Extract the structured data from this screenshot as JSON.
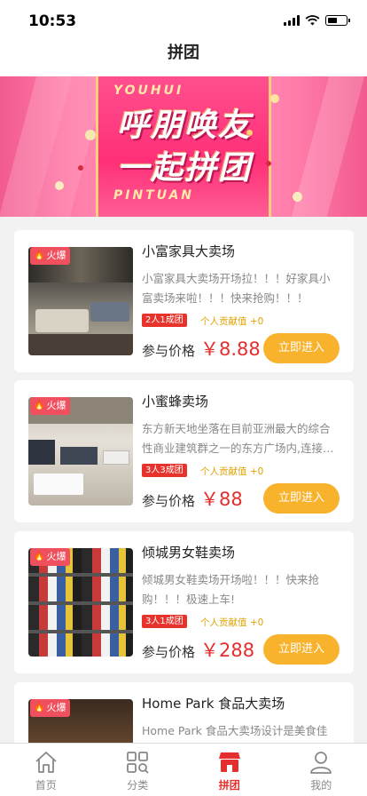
{
  "status": {
    "time": "10:53"
  },
  "nav": {
    "title": "拼团"
  },
  "banner": {
    "en_top": "YOUHUI",
    "line1": "呼朋唤友",
    "line2": "一起拼团",
    "en_bottom": "PINTUAN"
  },
  "cards": [
    {
      "title": "小富家具大卖场",
      "desc": "小富家具大卖场开场拉！！！好家具小富卖场来啦！！！快来抢购！！！",
      "group": "2人1成团",
      "contribution": "个人贡献值 +0",
      "price_label": "参与价格",
      "price": "￥8.88",
      "button": "立即进入",
      "hot": "火爆"
    },
    {
      "title": "小蜜蜂卖场",
      "desc": "东方新天地坐落在目前亚洲最大的综合性商业建筑群之一的东方广场内,连接…",
      "group": "3人3成团",
      "contribution": "个人贡献值 +0",
      "price_label": "参与价格",
      "price": "￥88",
      "button": "立即进入",
      "hot": "火爆"
    },
    {
      "title": "倾城男女鞋卖场",
      "desc": "倾城男女鞋卖场开场啦！！！快来抢购！！！极速上车!",
      "group": "3人1成团",
      "contribution": "个人贡献值 +0",
      "price_label": "参与价格",
      "price": "￥288",
      "button": "立即进入",
      "hot": "火爆"
    },
    {
      "title": "Home Park 食品大卖场",
      "desc": "Home Park 食品大卖场设计是美食佳肴,",
      "hot": "火爆"
    }
  ],
  "tabs": [
    {
      "label": "首页",
      "icon": "home-icon"
    },
    {
      "label": "分类",
      "icon": "category-icon"
    },
    {
      "label": "拼团",
      "icon": "group-shop-icon",
      "active": true
    },
    {
      "label": "我的",
      "icon": "profile-icon"
    }
  ],
  "colors": {
    "accent": "#e52e2e",
    "button": "#f8b22c",
    "banner": "#ff4f8f"
  }
}
